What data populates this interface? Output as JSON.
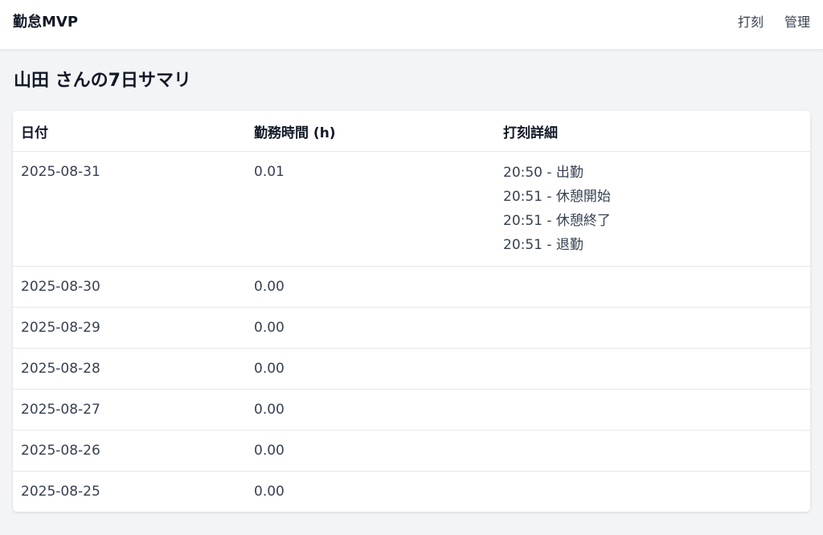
{
  "app": {
    "brand": "勤怠MVP",
    "nav": [
      {
        "label": "打刻"
      },
      {
        "label": "管理"
      }
    ]
  },
  "page": {
    "title": "山田 さんの7日サマリ"
  },
  "table": {
    "columns": [
      "日付",
      "勤務時間 (h)",
      "打刻詳細"
    ],
    "rows": [
      {
        "date": "2025-08-31",
        "hours": "0.01",
        "details": [
          "20:50 - 出勤",
          "20:51 - 休憩開始",
          "20:51 - 休憩終了",
          "20:51 - 退勤"
        ]
      },
      {
        "date": "2025-08-30",
        "hours": "0.00",
        "details": []
      },
      {
        "date": "2025-08-29",
        "hours": "0.00",
        "details": []
      },
      {
        "date": "2025-08-28",
        "hours": "0.00",
        "details": []
      },
      {
        "date": "2025-08-27",
        "hours": "0.00",
        "details": []
      },
      {
        "date": "2025-08-26",
        "hours": "0.00",
        "details": []
      },
      {
        "date": "2025-08-25",
        "hours": "0.00",
        "details": []
      }
    ]
  }
}
